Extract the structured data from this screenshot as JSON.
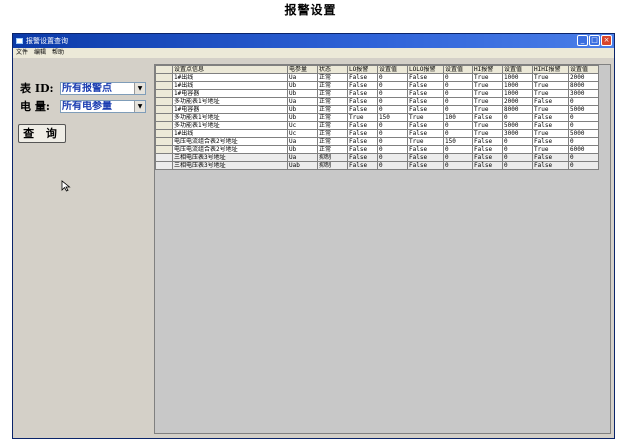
{
  "page_title": "报警设置",
  "window": {
    "title": "报警设置查询",
    "menu": [
      "文件",
      "编辑",
      "帮助"
    ],
    "controls": [
      "minimize-icon",
      "maximize-icon",
      "close-icon"
    ]
  },
  "filters": {
    "meter": {
      "label": "表 ID:",
      "value": "所有报警点"
    },
    "param": {
      "label": "电 量:",
      "value": "所有电参量"
    }
  },
  "query_button": "查 询",
  "grid": {
    "columns": [
      "设置点信息",
      "电参量",
      "状态",
      "LO报警",
      "设置值",
      "LOLO报警",
      "设置值",
      "HI报警",
      "设置值",
      "HIHI报警",
      "设置值"
    ],
    "rows": [
      [
        "1#出线",
        "Ua",
        "正常",
        "False",
        "0",
        "False",
        "0",
        "True",
        "1000",
        "True",
        "2000"
      ],
      [
        "1#出线",
        "Ub",
        "正常",
        "False",
        "0",
        "False",
        "0",
        "True",
        "1000",
        "True",
        "8000"
      ],
      [
        "1#电容器",
        "Ub",
        "正常",
        "False",
        "0",
        "False",
        "0",
        "True",
        "1000",
        "True",
        "3000"
      ],
      [
        "多功能表1号地址",
        "Ua",
        "正常",
        "False",
        "0",
        "False",
        "0",
        "True",
        "2000",
        "False",
        "0"
      ],
      [
        "1#电容器",
        "Ub",
        "正常",
        "False",
        "0",
        "False",
        "0",
        "True",
        "8000",
        "True",
        "5000"
      ],
      [
        "多功能表1号地址",
        "Ub",
        "正常",
        "True",
        "150",
        "True",
        "100",
        "False",
        "0",
        "False",
        "0"
      ],
      [
        "多功能表1号地址",
        "Uc",
        "正常",
        "False",
        "0",
        "False",
        "0",
        "True",
        "5000",
        "False",
        "0"
      ],
      [
        "1#出线",
        "Uc",
        "正常",
        "False",
        "0",
        "False",
        "0",
        "True",
        "3000",
        "True",
        "5000"
      ],
      [
        "电压电流组合表2号地址",
        "Ua",
        "正常",
        "False",
        "0",
        "True",
        "150",
        "False",
        "0",
        "False",
        "0"
      ],
      [
        "电压电流组合表2号地址",
        "Ub",
        "正常",
        "False",
        "0",
        "False",
        "0",
        "False",
        "0",
        "True",
        "6000"
      ],
      [
        "三相电压表3号地址",
        "Ua",
        "抑制",
        "False",
        "0",
        "False",
        "0",
        "False",
        "0",
        "False",
        "0"
      ],
      [
        "三相电压表3号地址",
        "Uab",
        "抑制",
        "False",
        "0",
        "False",
        "0",
        "False",
        "0",
        "False",
        "0"
      ]
    ]
  }
}
